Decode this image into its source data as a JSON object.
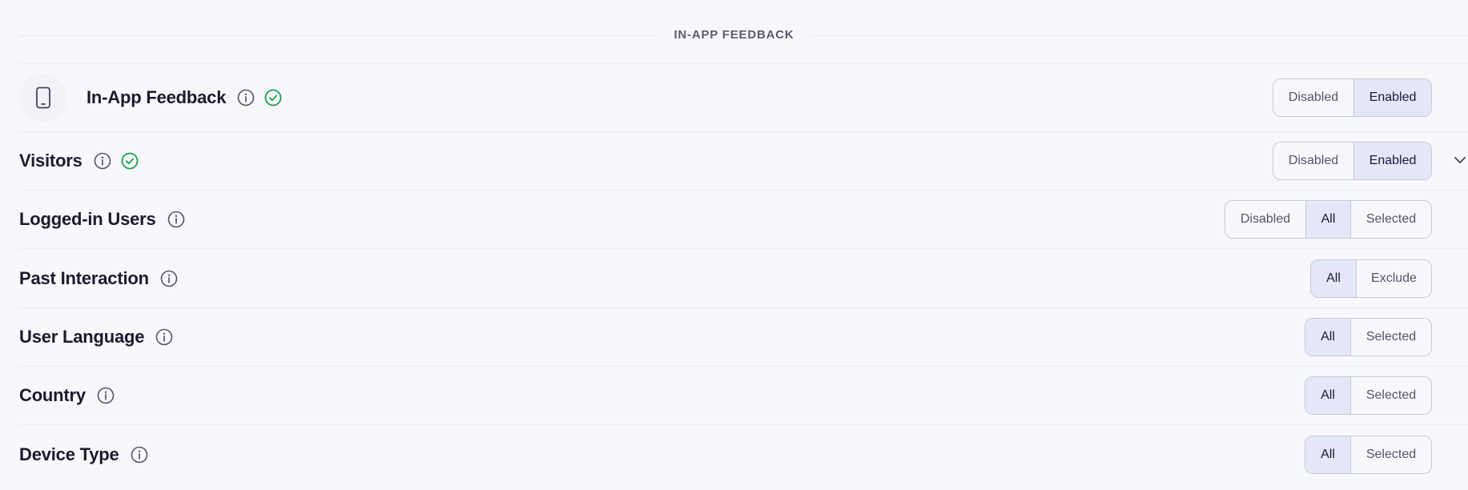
{
  "section": {
    "title": "IN-APP FEEDBACK"
  },
  "rows": [
    {
      "label": "In-App Feedback",
      "icon": "mobile-device-icon",
      "verified": true,
      "options": [
        "Disabled",
        "Enabled"
      ],
      "selected": "Enabled"
    },
    {
      "label": "Visitors",
      "verified": true,
      "expandable": true,
      "options": [
        "Disabled",
        "Enabled"
      ],
      "selected": "Enabled"
    },
    {
      "label": "Logged-in Users",
      "options": [
        "Disabled",
        "All",
        "Selected"
      ],
      "selected": "All"
    },
    {
      "label": "Past Interaction",
      "options": [
        "All",
        "Exclude"
      ],
      "selected": "All"
    },
    {
      "label": "User Language",
      "options": [
        "All",
        "Selected"
      ],
      "selected": "All"
    },
    {
      "label": "Country",
      "options": [
        "All",
        "Selected"
      ],
      "selected": "All"
    },
    {
      "label": "Device Type",
      "options": [
        "All",
        "Selected"
      ],
      "selected": "All"
    }
  ],
  "colors": {
    "background": "#f7f7fc",
    "active_segment": "#e3e7f8",
    "verified_green": "#16a34a",
    "border": "#c9c9d6"
  }
}
